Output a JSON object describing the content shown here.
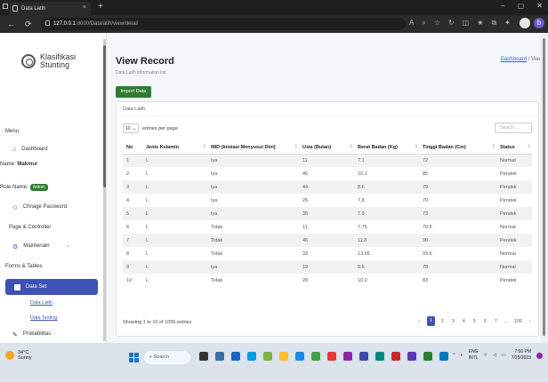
{
  "browser": {
    "tab_title": "Data Latih",
    "url_host": "127.0.0.1",
    "url_path": ":8000/Datalatih/view/detail"
  },
  "sidebar": {
    "brand_line1": "Klasifikasi",
    "brand_line2": "Stunting",
    "menu_heading": "Menu",
    "dashboard": "Dashboard",
    "name_label": "Name:",
    "name_value": "Makmur",
    "role_label": "Role Name:",
    "role_value": "Admin",
    "change_password": "Chnage Password",
    "page_controller": "Page & Controller",
    "maintenain": "Maintenain",
    "forms_tables": "Forms & Tables",
    "data_set": "Data Set",
    "data_latih": "Data Latih",
    "data_testing": "Data Testing",
    "probabilitas": "Probabilitas"
  },
  "page": {
    "title": "View Record",
    "subtitle": "Data Latih information list",
    "breadcrumb_home": "Dashboard",
    "breadcrumb_sep": "/",
    "breadcrumb_current": "View",
    "import_button": "Import Data",
    "card_title": "Data Latih",
    "entries_value": "10",
    "entries_label": "entries per page",
    "search_placeholder": "Search...",
    "info": "Showing 1 to 10 of 1055 entries"
  },
  "table": {
    "headers": [
      "No",
      "Jenis Kelamin",
      "IMD (Inisiasi Menyusui Dini)",
      "Usia (Bulan)",
      "Berat Badan (Kg)",
      "Tinggi Badan (Cm)",
      "Status"
    ],
    "rows": [
      [
        "1",
        "L",
        "Iya",
        "11",
        "7.1",
        "72",
        "Normal"
      ],
      [
        "2",
        "L",
        "Iya",
        "46",
        "10.1",
        "85",
        "Pendek"
      ],
      [
        "3",
        "L",
        "Iya",
        "44",
        "8.6",
        "79",
        "Pendek"
      ],
      [
        "4",
        "L",
        "Iya",
        "25",
        "7.8",
        "70",
        "Pendek"
      ],
      [
        "5",
        "L",
        "Iya",
        "35",
        "7.9",
        "73",
        "Pendek"
      ],
      [
        "6",
        "L",
        "Tidak",
        "11",
        "7.75",
        "70.6",
        "Normal"
      ],
      [
        "7",
        "L",
        "Tidak",
        "46",
        "11.8",
        "90",
        "Pendek"
      ],
      [
        "8",
        "L",
        "Tidak",
        "33",
        "13.95",
        "93.6",
        "Normal"
      ],
      [
        "9",
        "L",
        "Iya",
        "19",
        "9.5",
        "78",
        "Normal"
      ],
      [
        "10",
        "L",
        "Tidak",
        "28",
        "10.9",
        "83",
        "Pendek"
      ]
    ]
  },
  "pager": {
    "prev": "‹",
    "pages": [
      "1",
      "2",
      "3",
      "4",
      "5",
      "6",
      "7",
      "...",
      "106"
    ],
    "next": "›"
  },
  "taskbar": {
    "temp": "34°C",
    "weather": "Sunny",
    "search": "Search",
    "lang1": "ENG",
    "lang2": "INTL",
    "time": "7:50 PM",
    "date": "7/25/2023"
  },
  "colors": {
    "accent": "#3f51b5",
    "import": "#2e7d32"
  }
}
